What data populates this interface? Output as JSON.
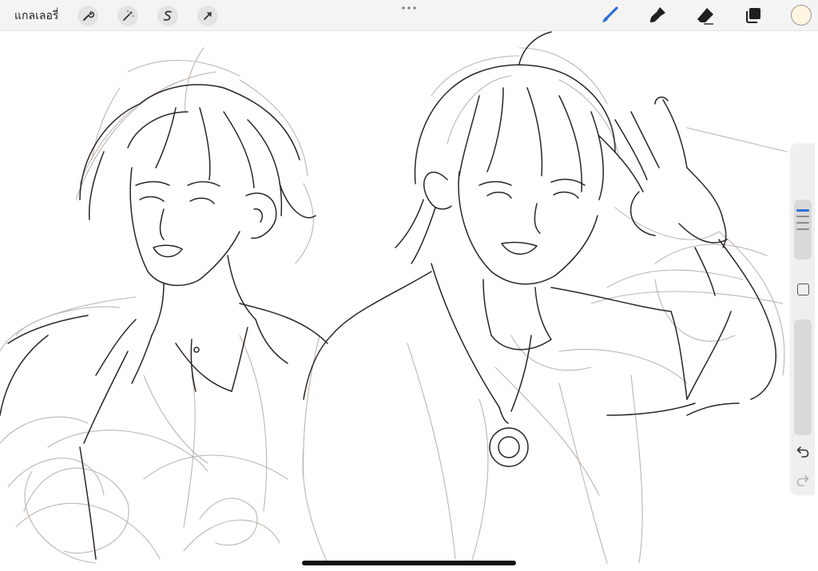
{
  "topbar": {
    "gallery_label": "แกลเลอรี่",
    "left_tools": [
      {
        "name": "actions",
        "icon": "wrench-icon"
      },
      {
        "name": "adjustments",
        "icon": "magic-wand-icon"
      },
      {
        "name": "selection",
        "icon": "selection-s-icon"
      },
      {
        "name": "transform",
        "icon": "arrow-cursor-icon"
      }
    ],
    "right_tools": [
      {
        "name": "brush",
        "icon": "brush-icon",
        "active": true
      },
      {
        "name": "smudge",
        "icon": "smudge-icon"
      },
      {
        "name": "eraser",
        "icon": "eraser-icon"
      },
      {
        "name": "layers",
        "icon": "layers-icon"
      }
    ],
    "current_color": "#fff5e0"
  },
  "sidebar": {
    "brush_size_level": 0.18,
    "opacity_level": 0,
    "undo_icon": "undo-icon",
    "redo_icon": "redo-icon",
    "redo_enabled": false
  },
  "colors": {
    "accent": "#2f6fd6",
    "topbar_bg": "#f4f4f4",
    "ink": "#2b2522",
    "sketch": "#b9b3ae"
  }
}
